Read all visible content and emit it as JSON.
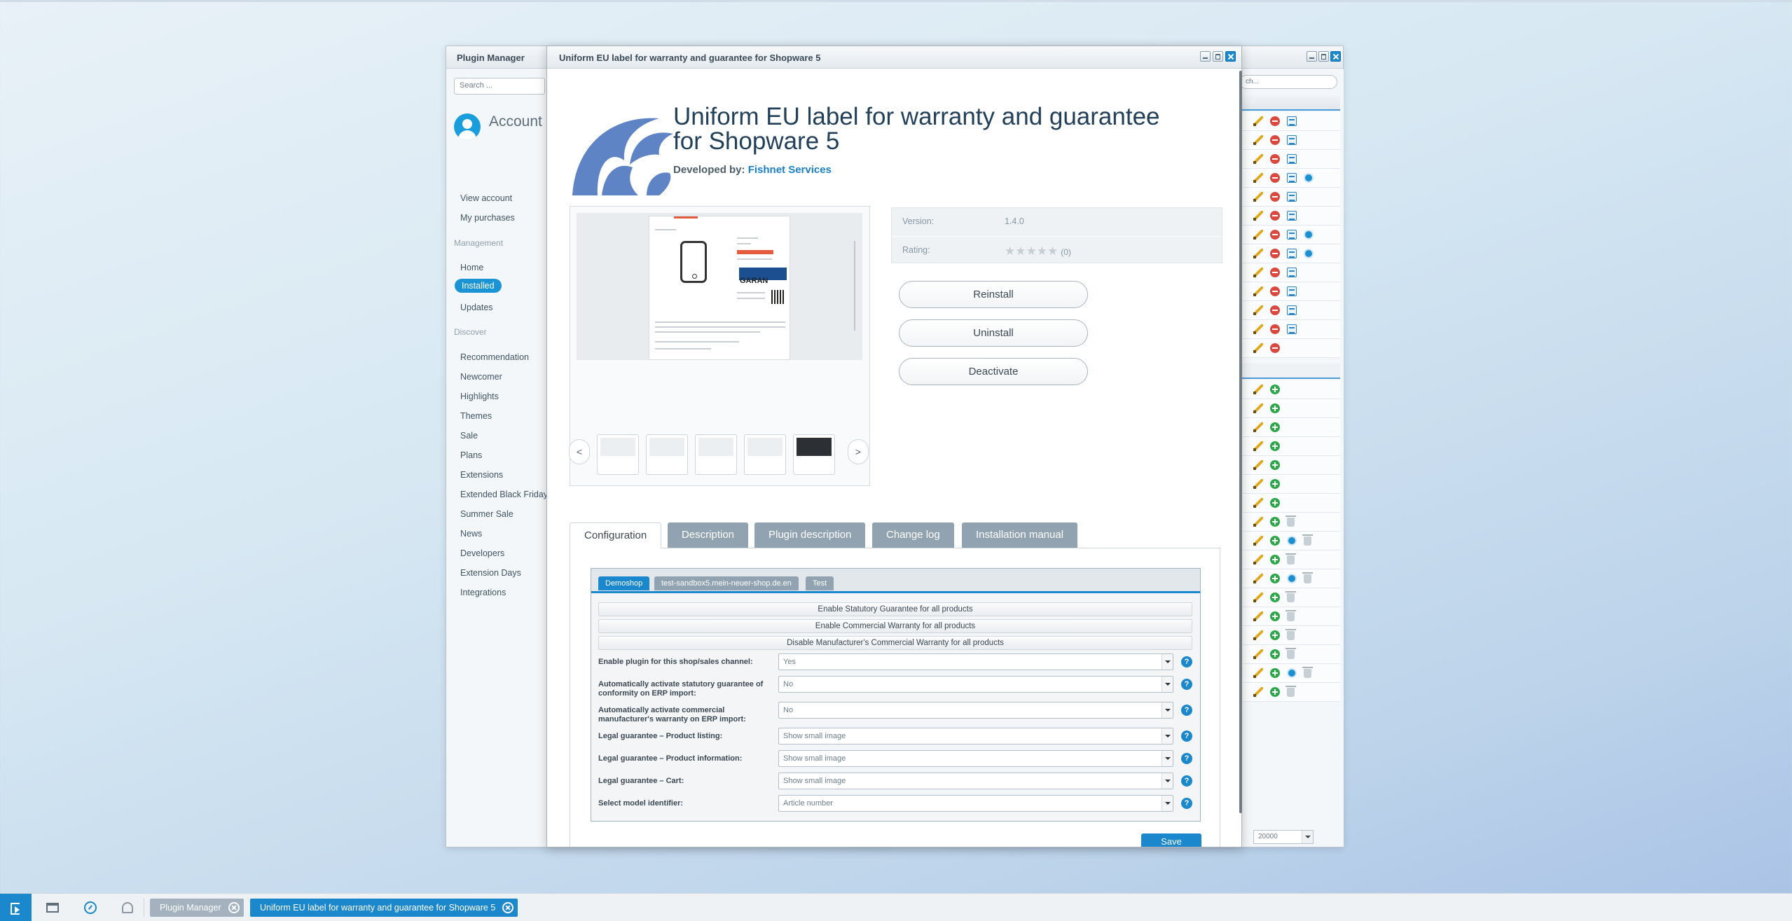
{
  "plugin_manager": {
    "title": "Plugin Manager",
    "search_placeholder": "Search ...",
    "account_label": "Account",
    "account_links": [
      "View account",
      "My purchases"
    ],
    "management_heading": "Management",
    "management_items": [
      "Home",
      "Installed",
      "Updates"
    ],
    "active_item": "Installed",
    "discover_heading": "Discover",
    "discover_items": [
      "Recommendation",
      "Newcomer",
      "Highlights",
      "Themes",
      "Sale",
      "Plans",
      "Extensions",
      "Extended Black Friday",
      "Summer Sale",
      "News",
      "Developers",
      "Extension Days",
      "Integrations"
    ],
    "grid_search_placeholder": "ch...",
    "paging_size": "20000"
  },
  "detail": {
    "window_title": "Uniform EU label for warranty and guarantee for Shopware 5",
    "plugin_title": "Uniform EU label for warranty and guarantee for Shopware 5",
    "developed_by_label": "Developed by:",
    "developer": "Fishnet Services",
    "version_label": "Version:",
    "version": "1.4.0",
    "rating_label": "Rating:",
    "rating_stars": "★★★★★",
    "rating_count": "(0)",
    "buttons": {
      "reinstall": "Reinstall",
      "uninstall": "Uninstall",
      "deactivate": "Deactivate"
    },
    "gallery": {
      "prev": "<",
      "next": ">",
      "screenshot_word": "GARAN"
    },
    "tabs": [
      "Configuration",
      "Description",
      "Plugin description",
      "Change log",
      "Installation manual"
    ],
    "active_tab": "Configuration",
    "config": {
      "shops": [
        "Demoshop",
        "test-sandbox5.mein-neuer-shop.de.en",
        "Test"
      ],
      "active_shop": "Demoshop",
      "action_buttons": [
        "Enable Statutory Guarantee for all products",
        "Enable Commercial Warranty for all products",
        "Disable Manufacturer's Commercial Warranty for all products"
      ],
      "fields": [
        {
          "label": "Enable plugin for this shop/sales channel:",
          "value": "Yes"
        },
        {
          "label": "Automatically activate statutory guarantee of conformity on ERP import:",
          "value": "No"
        },
        {
          "label": "Automatically activate commercial manufacturer's warranty on ERP import:",
          "value": "No"
        },
        {
          "label": "Legal guarantee – Product listing:",
          "value": "Show small image"
        },
        {
          "label": "Legal guarantee – Product information:",
          "value": "Show small image"
        },
        {
          "label": "Legal guarantee – Cart:",
          "value": "Show small image"
        },
        {
          "label": "Select model identifier:",
          "value": "Article number"
        }
      ],
      "help_glyph": "?",
      "save_label": "Save"
    }
  },
  "taskbar": {
    "items": [
      "Plugin Manager",
      "Uniform EU label for warranty and guarantee for Shopware 5"
    ],
    "active_color": "#1b87cc",
    "inactive_color": "#a3b2be"
  },
  "colors": {
    "accent": "#1b87cc",
    "title": "#23405a",
    "logo": "#5f84c6"
  }
}
